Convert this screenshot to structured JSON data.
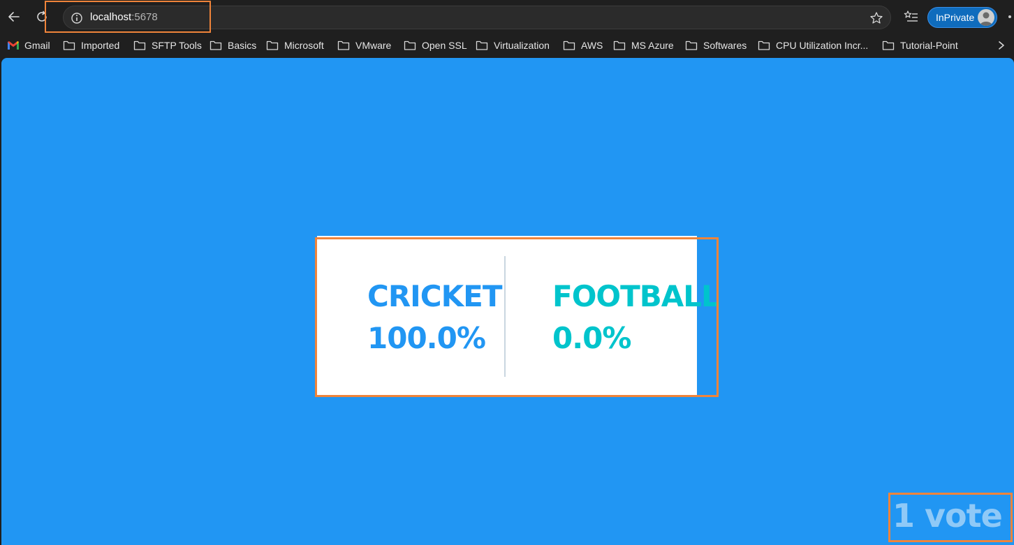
{
  "browser": {
    "url_host": "localhost",
    "url_port": ":5678",
    "inprivate_label": "InPrivate",
    "icons": {
      "back": "arrow-left-icon",
      "reload": "reload-icon",
      "info": "info-icon",
      "star": "star-icon",
      "favorites": "favorites-list-icon",
      "avatar": "avatar-icon"
    }
  },
  "bookmarks": [
    {
      "label": "Gmail",
      "icon": "gmail-icon"
    },
    {
      "label": "Imported",
      "icon": "folder-icon"
    },
    {
      "label": "SFTP Tools",
      "icon": "folder-icon"
    },
    {
      "label": "Basics",
      "icon": "folder-icon"
    },
    {
      "label": "Microsoft",
      "icon": "folder-icon"
    },
    {
      "label": "VMware",
      "icon": "folder-icon"
    },
    {
      "label": "Open SSL",
      "icon": "folder-icon"
    },
    {
      "label": "Virtualization",
      "icon": "folder-icon"
    },
    {
      "label": "AWS",
      "icon": "folder-icon"
    },
    {
      "label": "MS Azure",
      "icon": "folder-icon"
    },
    {
      "label": "Softwares",
      "icon": "folder-icon"
    },
    {
      "label": "CPU Utilization Incr...",
      "icon": "folder-icon"
    },
    {
      "label": "Tutorial-Point",
      "icon": "folder-icon"
    }
  ],
  "results": {
    "option_a": {
      "name": "CRICKET",
      "percent": "100.0%",
      "color": "#2196f3"
    },
    "option_b": {
      "name": "FOOTBALL",
      "percent": "0.0%",
      "color": "#00c4cc"
    },
    "votes": "1 vote"
  },
  "colors": {
    "page_background": "#2196f3",
    "card_background": "#ffffff",
    "annotation": "#f0843a",
    "chrome": "#1f1f1f"
  }
}
